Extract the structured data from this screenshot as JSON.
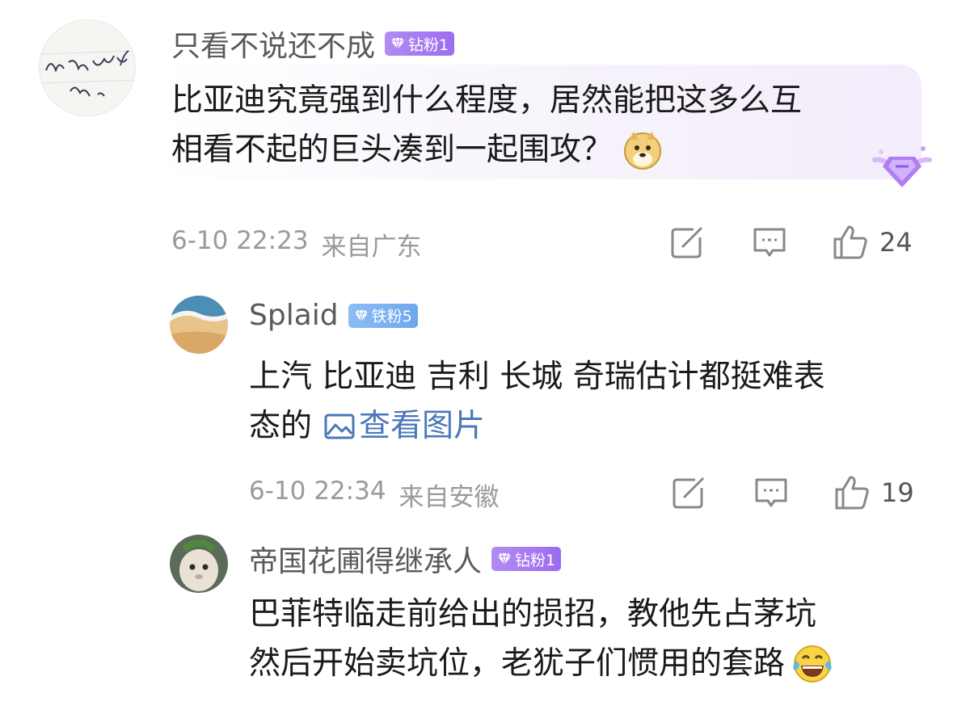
{
  "comments": [
    {
      "username": "只看不说还不成",
      "badge": "钻粉1",
      "badge_color": "#a67cf2",
      "lines": [
        "比亚迪究竟强到什么程度，居然能把这多么互",
        "相看不起的巨头凑到一起围攻？"
      ],
      "emoji": "doge-emoji",
      "timestamp": "6-10 22:23",
      "location": "来自广东",
      "likes": "24"
    },
    {
      "username": "Splaid",
      "badge": "铁粉5",
      "badge_color": "#7aaef0",
      "lines": [
        "上汽 比亚迪 吉利 长城 奇瑞估计都挺难表",
        "态的"
      ],
      "link_text": "查看图片",
      "timestamp": "6-10 22:34",
      "location": "来自安徽",
      "likes": "19"
    },
    {
      "username": "帝国花圃得继承人",
      "badge": "钻粉1",
      "badge_color": "#a67cf2",
      "lines": [
        "巴菲特临走前给出的损招，教他先占茅坑",
        "然后开始卖坑位，老犹子们惯用的套路"
      ],
      "emoji": "laughing-tears-emoji"
    }
  ]
}
